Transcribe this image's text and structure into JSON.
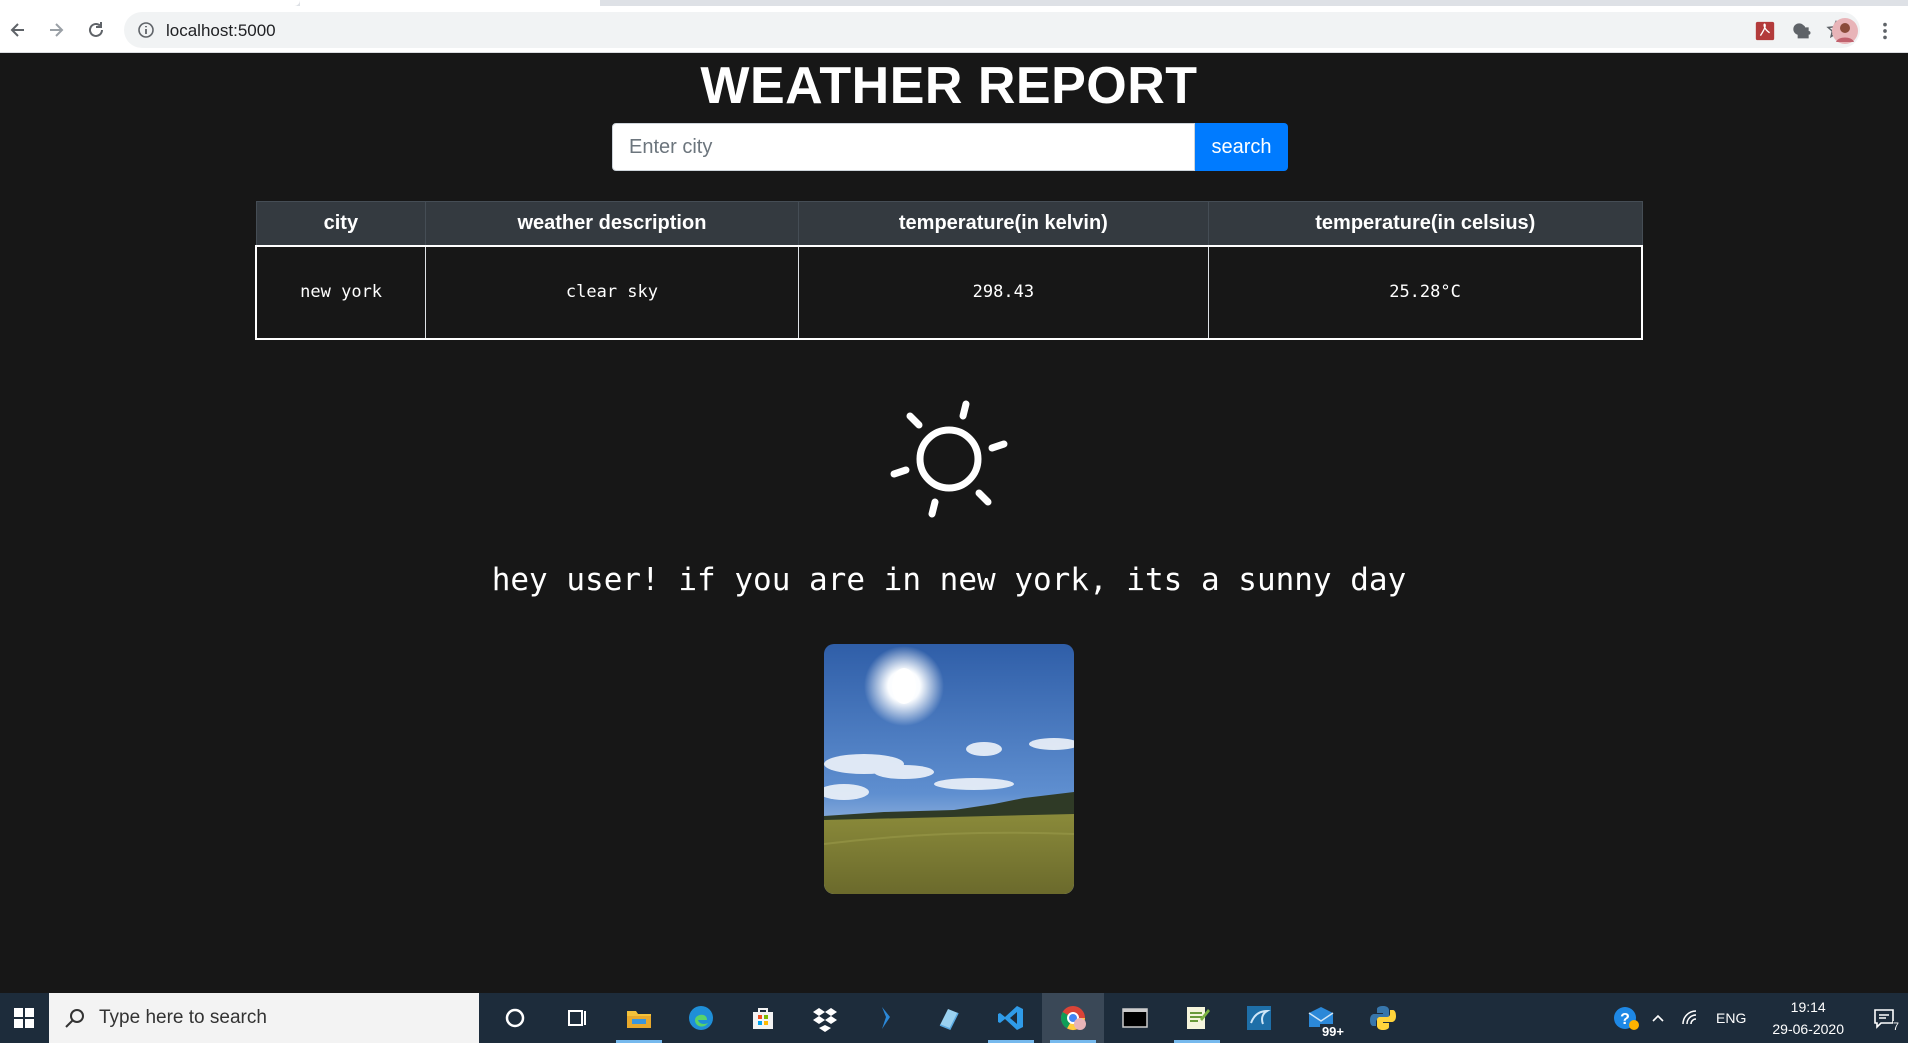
{
  "browser": {
    "url": "localhost:5000"
  },
  "page": {
    "title": "WEATHER REPORT",
    "search": {
      "placeholder": "Enter city",
      "value": "",
      "button_label": "search"
    },
    "table": {
      "headers": [
        "city",
        "weather description",
        "temperature(in kelvin)",
        "temperature(in celsius)"
      ],
      "rows": [
        [
          "new york",
          "clear sky",
          "298.43",
          "25.28°C"
        ]
      ]
    },
    "weather_icon": "sun-icon",
    "message": "hey user! if you are in new york, its a sunny day",
    "photo_subject": "sunny sky over field"
  },
  "taskbar": {
    "search_placeholder": "Type here to search",
    "mail_badge": "99+",
    "language": "ENG",
    "time": "19:14",
    "date": "29-06-2020",
    "notification_count": "7"
  },
  "colors": {
    "page_background": "#171717",
    "search_button": "#007bff",
    "table_header": "#343a40",
    "taskbar": "#1d2c3b"
  }
}
